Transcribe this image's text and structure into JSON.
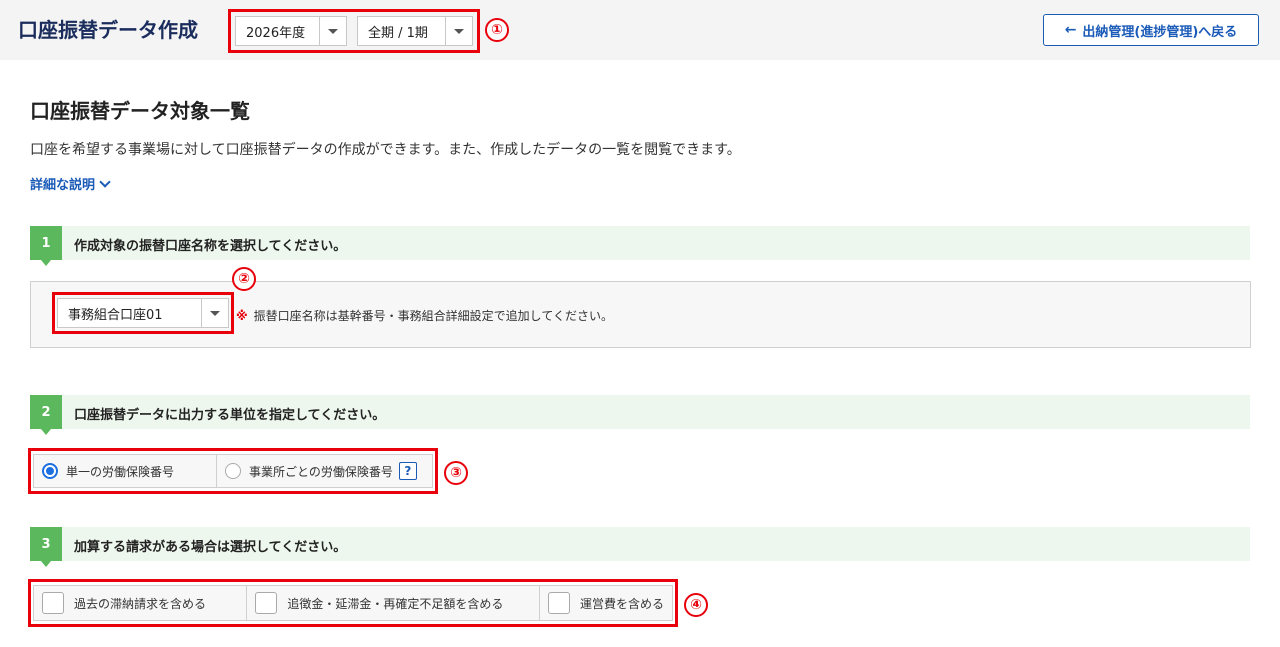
{
  "header": {
    "title": "口座振替データ作成",
    "year_select": "2026年度",
    "period_select": "全期 / 1期",
    "back_button": "出納管理(進捗管理)へ戻る"
  },
  "main": {
    "heading": "口座振替データ対象一覧",
    "description": "口座を希望する事業場に対して口座振替データの作成ができます。また、作成したデータの一覧を閲覧できます。",
    "more_link": "詳細な説明"
  },
  "steps": [
    {
      "num": "1",
      "label": "作成対象の振替口座名称を選択してください。"
    },
    {
      "num": "2",
      "label": "口座振替データに出力する単位を指定してください。"
    },
    {
      "num": "3",
      "label": "加算する請求がある場合は選択してください。"
    }
  ],
  "account": {
    "select_value": "事務組合口座01",
    "note_mark": "※",
    "note": "振替口座名称は基幹番号・事務組合詳細設定で追加してください。"
  },
  "unit_options": [
    {
      "label": "単一の労働保険番号",
      "selected": true
    },
    {
      "label": "事業所ごとの労働保険番号",
      "selected": false
    }
  ],
  "help_label": "?",
  "addons": [
    {
      "label": "過去の滞納請求を含める",
      "checked": false
    },
    {
      "label": "追徴金・延滞金・再確定不足額を含める",
      "checked": false
    },
    {
      "label": "運営費を含める",
      "checked": false
    }
  ],
  "annotations": [
    "①",
    "②",
    "③",
    "④"
  ],
  "colors": {
    "accent": "#1b5bb8",
    "step": "#5cb85c",
    "highlight": "#e8000b"
  }
}
